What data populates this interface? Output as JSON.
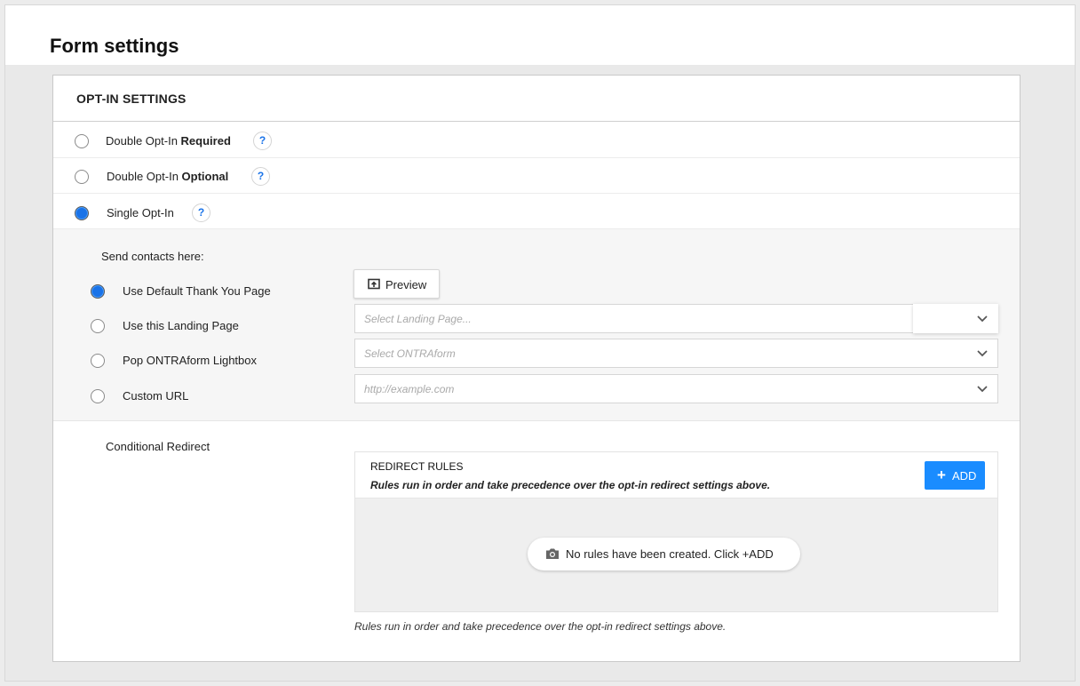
{
  "page": {
    "title": "Form settings"
  },
  "optin": {
    "section_title": "OPT-IN SETTINGS",
    "help_glyph": "?",
    "options": [
      {
        "label_prefix": "Double Opt-In ",
        "label_bold": "Required",
        "selected": false
      },
      {
        "label_prefix": "Double Opt-In ",
        "label_bold": "Optional",
        "selected": false
      },
      {
        "label_prefix": "Single Opt-In",
        "label_bold": "",
        "selected": true
      }
    ]
  },
  "send": {
    "label": "Send contacts here:",
    "destinations": [
      {
        "label": "Use Default Thank You Page",
        "selected": true
      },
      {
        "label": "Use this Landing Page",
        "selected": false,
        "placeholder": "Select Landing Page..."
      },
      {
        "label": "Pop ONTRAform Lightbox",
        "selected": false,
        "placeholder": "Select ONTRAform"
      },
      {
        "label": "Custom URL",
        "selected": false,
        "placeholder": "http://example.com"
      }
    ],
    "preview_label": "Preview"
  },
  "redirect": {
    "label": "Conditional Redirect",
    "rules_title": "REDIRECT RULES",
    "rules_subtitle": "Rules run in order and take precedence over the opt-in redirect settings above.",
    "add_label": "ADD",
    "add_icon": "plus-icon",
    "empty_message": "No rules have been created. Click +ADD",
    "empty_icon": "camera-icon",
    "footnote": "Rules run in order and take precedence over the opt-in redirect settings above."
  },
  "colors": {
    "accent": "#1a8cff",
    "radio_selected": "#1a73e8"
  }
}
